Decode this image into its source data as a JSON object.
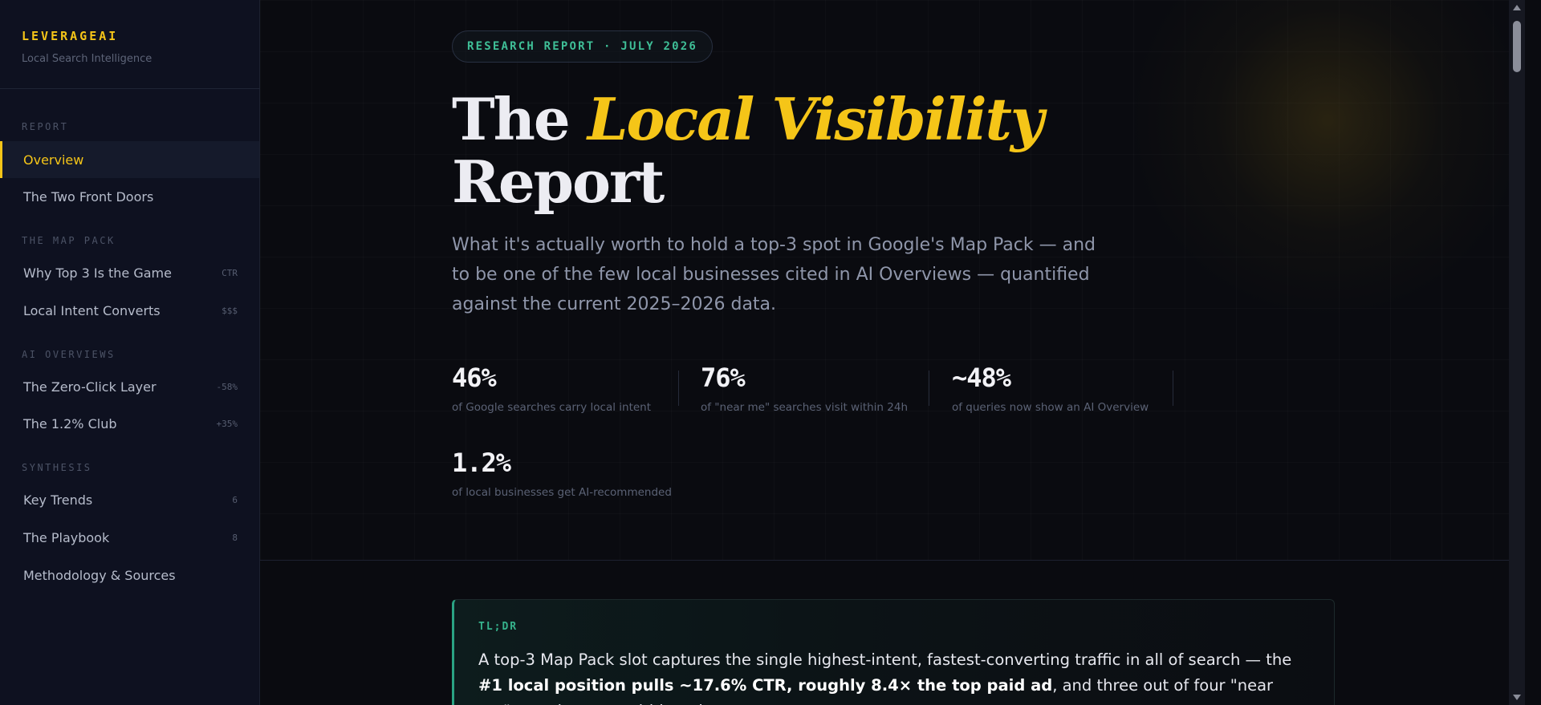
{
  "brand": {
    "name": "LEVERAGEAI",
    "tagline": "Local Search Intelligence"
  },
  "sidebar": {
    "sections": [
      {
        "label": "REPORT"
      },
      {
        "label": "THE MAP PACK"
      },
      {
        "label": "AI OVERVIEWS"
      },
      {
        "label": "SYNTHESIS"
      }
    ],
    "items": [
      {
        "label": "Overview",
        "badge": "",
        "active": true
      },
      {
        "label": "The Two Front Doors",
        "badge": ""
      },
      {
        "label": "Why Top 3 Is the Game",
        "badge": "CTR"
      },
      {
        "label": "Local Intent Converts",
        "badge": "$$$"
      },
      {
        "label": "The Zero-Click Layer",
        "badge": "-58%"
      },
      {
        "label": "The 1.2% Club",
        "badge": "+35%"
      },
      {
        "label": "Key Trends",
        "badge": "6"
      },
      {
        "label": "The Playbook",
        "badge": "8"
      },
      {
        "label": "Methodology & Sources",
        "badge": ""
      }
    ]
  },
  "hero": {
    "eyebrow": "RESEARCH REPORT · JULY 2026",
    "title_pre": "The ",
    "title_highlight": "Local Visibility",
    "title_post": "Report",
    "lede": "What it's actually worth to hold a top-3 spot in Google's Map Pack — and to be one of the few local businesses cited in AI Overviews — quantified against the current 2025–2026 data."
  },
  "stats": [
    {
      "value": "46%",
      "label": "of Google searches carry local intent"
    },
    {
      "value": "76%",
      "label": "of \"near me\" searches visit within 24h"
    },
    {
      "value": "~48%",
      "label": "of queries now show an AI Overview"
    },
    {
      "value": "1.2%",
      "label": "of local businesses get AI-recommended"
    }
  ],
  "tldr": {
    "label": "TL;DR",
    "text_1": "A top-3 Map Pack slot captures the single highest-intent, fastest-converting traffic in all of search — the ",
    "text_bold": "#1 local position pulls ~17.6% CTR, roughly 8.4× the top paid ad",
    "text_2": ", and three out of four \"near me\" searchers act within a day."
  },
  "colors": {
    "accent": "#f5c518",
    "teal": "#3fbf97",
    "background": "#0a0b10",
    "sidebar": "#0e1120"
  }
}
